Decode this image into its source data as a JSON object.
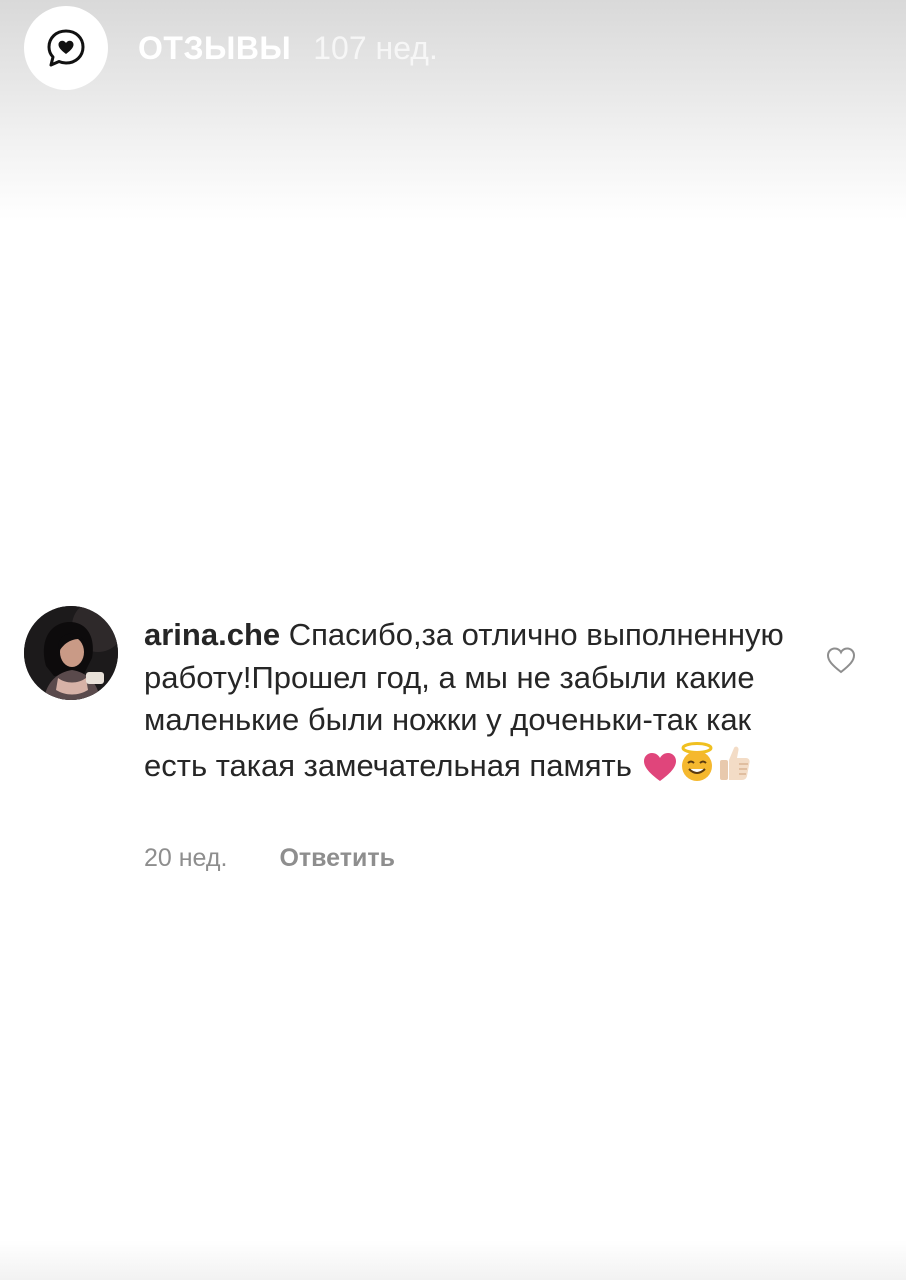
{
  "story": {
    "title": "ОТЗЫВЫ",
    "time": "107 нед.",
    "avatar_icon": "heart-speech-bubble-icon"
  },
  "comment": {
    "username": "arina.che",
    "text": "Спасибо,за отлично выполненную работу!Прошел год, а мы не забыли какие маленькие были ножки у доченьки-так как есть такая замечательная память",
    "emojis": [
      "pink-heart-icon",
      "smiling-face-with-halo-icon",
      "thumbs-up-icon"
    ],
    "time": "20 нед.",
    "reply_label": "Ответить",
    "like_icon": "heart-outline-icon"
  },
  "colors": {
    "text": "#262626",
    "muted": "#8e8e8e",
    "heart": "#e0457b",
    "halo_face": "#f5b82e"
  }
}
